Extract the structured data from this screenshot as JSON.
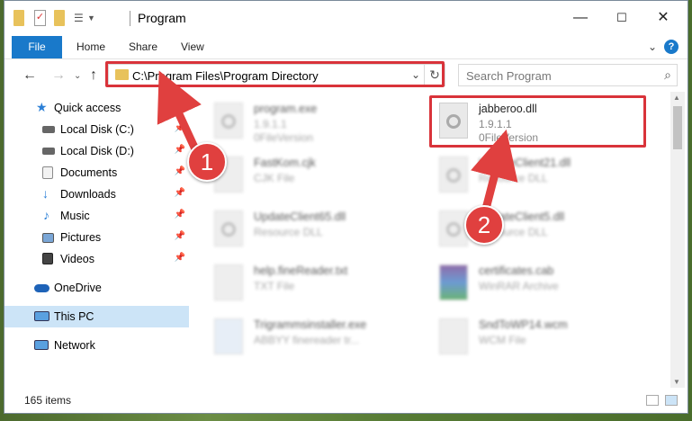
{
  "window": {
    "title": "Program"
  },
  "ribbon": {
    "file": "File",
    "tabs": [
      "Home",
      "Share",
      "View"
    ],
    "help": "?"
  },
  "address": {
    "path": "C:\\Program Files\\Program Directory"
  },
  "search": {
    "placeholder": "Search Program"
  },
  "sidebar": {
    "items": [
      {
        "label": "Quick access",
        "icon": "star-icon"
      },
      {
        "label": "Local Disk (C:)",
        "icon": "drive-icon",
        "pinned": true
      },
      {
        "label": "Local Disk (D:)",
        "icon": "drive-icon",
        "pinned": true
      },
      {
        "label": "Documents",
        "icon": "documents-icon",
        "pinned": true
      },
      {
        "label": "Downloads",
        "icon": "download-icon",
        "pinned": true
      },
      {
        "label": "Music",
        "icon": "music-icon",
        "pinned": true
      },
      {
        "label": "Pictures",
        "icon": "pictures-icon",
        "pinned": true
      },
      {
        "label": "Videos",
        "icon": "videos-icon",
        "pinned": true
      },
      {
        "label": "OneDrive",
        "icon": "cloud-icon"
      },
      {
        "label": "This PC",
        "icon": "computer-icon",
        "selected": true
      },
      {
        "label": "Network",
        "icon": "network-icon"
      }
    ]
  },
  "files": [
    {
      "name": "program.exe",
      "line2": "1.9.1.1",
      "line3": "0FileVersion"
    },
    {
      "name": "jabberoo.dll",
      "line2": "1.9.1.1",
      "line3": "0FileVersion"
    },
    {
      "name": "FastKom.cjk",
      "line2": "CJK File"
    },
    {
      "name": "UpdateClient21.dll",
      "line2": "Resource DLL"
    },
    {
      "name": "UpdateClient65.dll",
      "line2": "Resource DLL"
    },
    {
      "name": "UpdateClient5.dll",
      "line2": "Resource DLL"
    },
    {
      "name": "help.fineReader.txt",
      "line2": "TXT File"
    },
    {
      "name": "certificates.cab",
      "line2": "WinRAR Archive"
    },
    {
      "name": "Trigrammsinstaller.exe",
      "line2": "ABBYY finereader tr..."
    },
    {
      "name": "SndToWP14.wcm",
      "line2": "WCM File"
    }
  ],
  "status": {
    "count": "165 items"
  },
  "annotations": {
    "step1": "1",
    "step2": "2"
  },
  "colors": {
    "accent": "#1979ca",
    "highlight": "#d9333a",
    "selected": "#cce4f7"
  }
}
